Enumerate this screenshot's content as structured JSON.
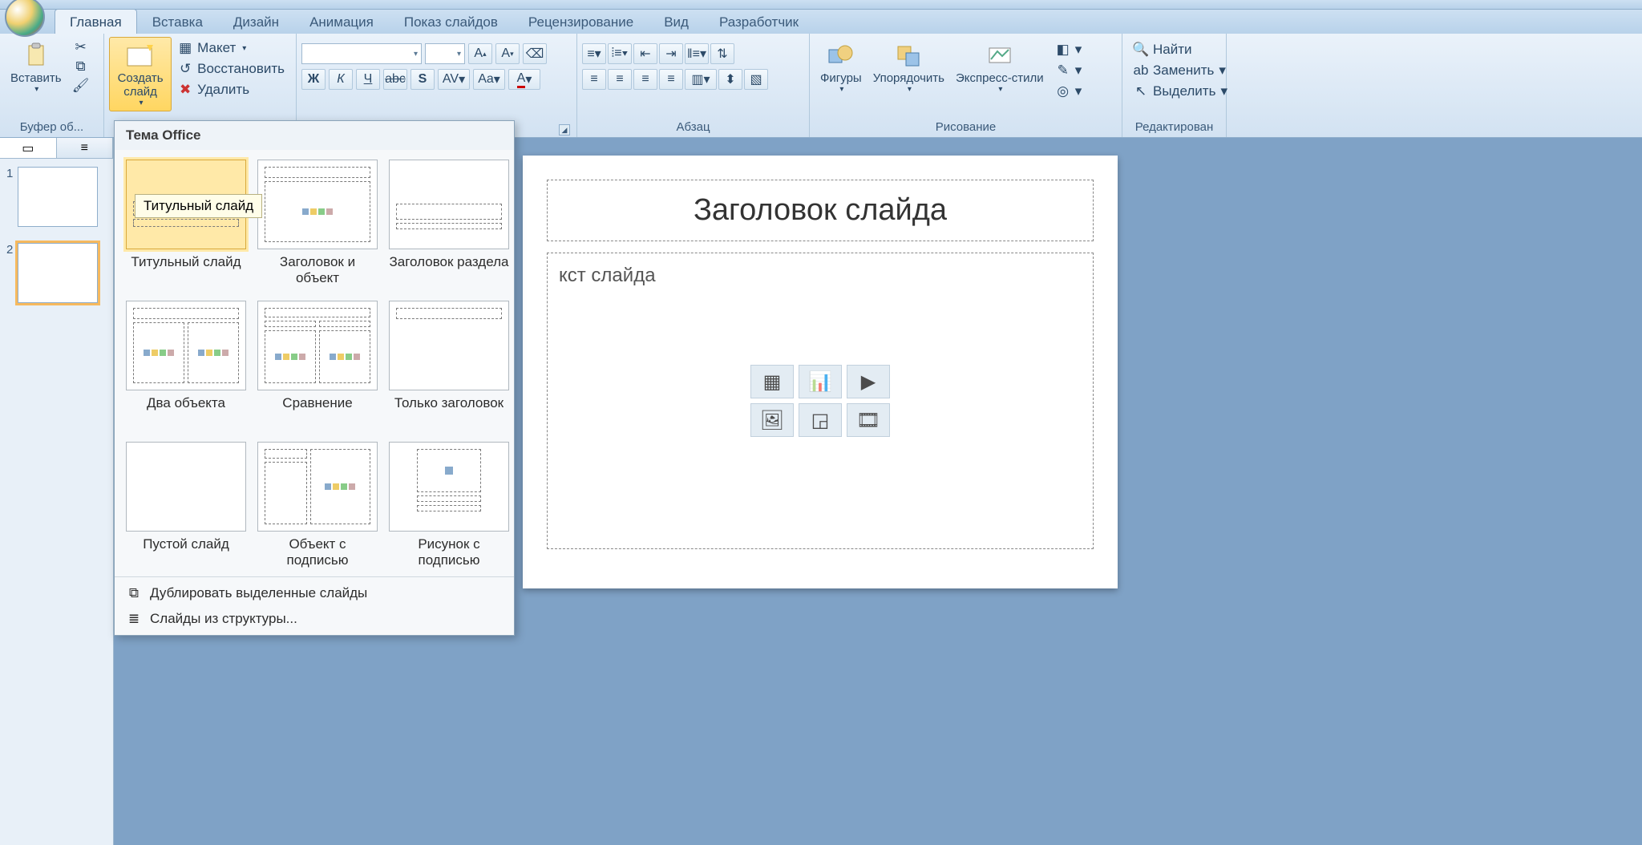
{
  "tabs": {
    "home": "Главная",
    "insert": "Вставка",
    "design": "Дизайн",
    "animation": "Анимация",
    "slideshow": "Показ слайдов",
    "review": "Рецензирование",
    "view": "Вид",
    "developer": "Разработчик"
  },
  "ribbon": {
    "clipboard": {
      "paste": "Вставить",
      "group_label": "Буфер об..."
    },
    "slides": {
      "new_slide": "Создать слайд",
      "layout": "Макет",
      "reset": "Восстановить",
      "delete": "Удалить"
    },
    "font": {
      "bold": "Ж",
      "italic": "К",
      "underline": "Ч",
      "strike": "abc",
      "shadow": "S",
      "spacing": "AV",
      "case": "Aa",
      "color": "A"
    },
    "paragraph": {
      "group_label": "Абзац"
    },
    "drawing": {
      "shapes": "Фигуры",
      "arrange": "Упорядочить",
      "quick_styles": "Экспресс-стили",
      "group_label": "Рисование"
    },
    "editing": {
      "find": "Найти",
      "replace": "Заменить",
      "select": "Выделить",
      "group_label": "Редактирован"
    }
  },
  "gallery": {
    "theme_title": "Тема Office",
    "layouts": [
      "Титульный слайд",
      "Заголовок и объект",
      "Заголовок раздела",
      "Два объекта",
      "Сравнение",
      "Только заголовок",
      "Пустой слайд",
      "Объект с подписью",
      "Рисунок с подписью"
    ],
    "tooltip": "Титульный слайд",
    "footer": {
      "duplicate": "Дублировать выделенные слайды",
      "from_outline": "Слайды из структуры..."
    }
  },
  "left_panel": {
    "slide1": "1",
    "slide2": "2"
  },
  "slide": {
    "title_placeholder": "Заголовок слайда",
    "body_placeholder_fragment": "кст слайда"
  }
}
